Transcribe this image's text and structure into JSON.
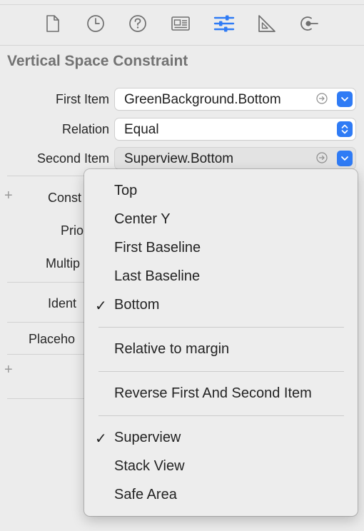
{
  "tabs": [
    {
      "icon": "file-icon",
      "active": false
    },
    {
      "icon": "clock-icon",
      "active": false
    },
    {
      "icon": "help-icon",
      "active": false
    },
    {
      "icon": "identity-card-icon",
      "active": false
    },
    {
      "icon": "sliders-icon",
      "active": true
    },
    {
      "icon": "ruler-icon",
      "active": false
    },
    {
      "icon": "connections-icon",
      "active": false
    }
  ],
  "colors": {
    "accent": "#2f7bf5",
    "title": "#737373"
  },
  "title": "Vertical Space Constraint",
  "first_item": {
    "label": "First Item",
    "value": "GreenBackground.Bottom"
  },
  "relation": {
    "label": "Relation",
    "value": "Equal"
  },
  "second_item": {
    "label": "Second Item",
    "value": "Superview.Bottom"
  },
  "background_labels": {
    "constant": "Const",
    "priority": "Prio",
    "multiplier": "Multip",
    "identifier": "Ident",
    "placeholder": "Placeho",
    "plus": "+"
  },
  "menu": {
    "group1": [
      {
        "label": "Top",
        "checked": false
      },
      {
        "label": "Center Y",
        "checked": false
      },
      {
        "label": "First Baseline",
        "checked": false
      },
      {
        "label": "Last Baseline",
        "checked": false
      },
      {
        "label": "Bottom",
        "checked": true
      }
    ],
    "relative_to_margin": "Relative to margin",
    "reverse": "Reverse First And Second Item",
    "group2": [
      {
        "label": "Superview",
        "checked": true
      },
      {
        "label": "Stack View",
        "checked": false
      },
      {
        "label": "Safe Area",
        "checked": false
      }
    ],
    "check_mark": "✓"
  }
}
